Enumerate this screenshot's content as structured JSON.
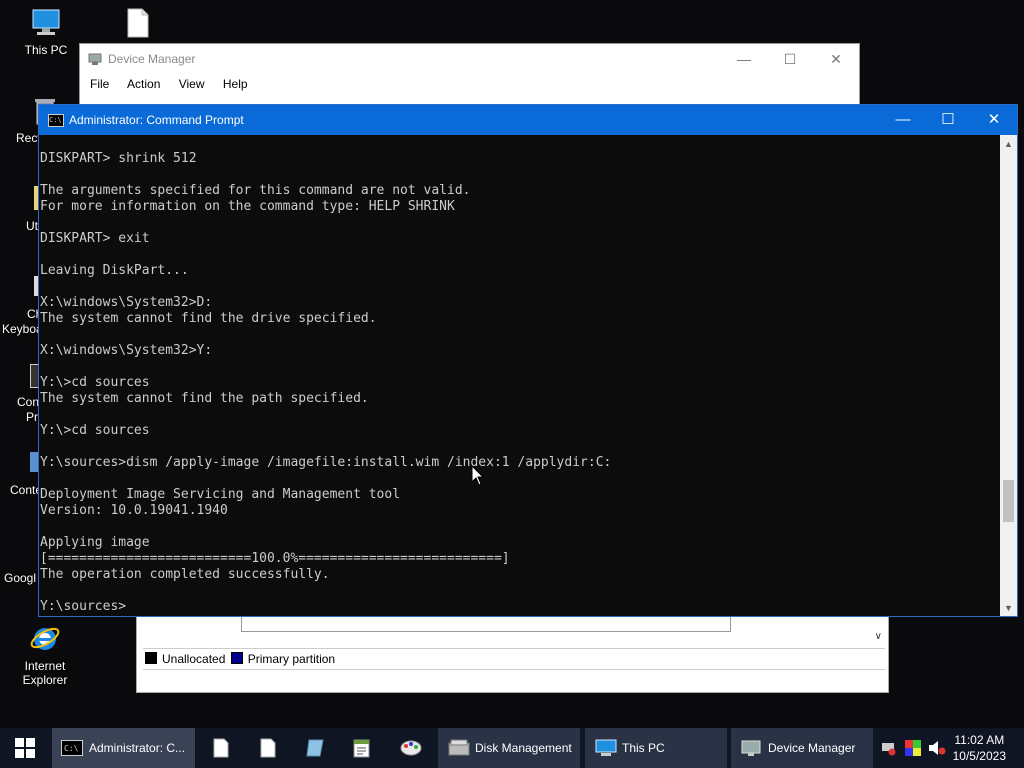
{
  "desktop": {
    "this_pc_label": "This PC",
    "internet_explorer_label": "Internet Explorer",
    "partial_labels": [
      "Recy",
      "Ut",
      "Ch",
      "Keyboa",
      "Con",
      "Pr",
      "Conte",
      "Googl"
    ]
  },
  "device_manager": {
    "title": "Device Manager",
    "menu": [
      "File",
      "Action",
      "View",
      "Help"
    ]
  },
  "disk_management": {
    "legend": [
      "Unallocated",
      "Primary partition"
    ],
    "legend_colors": [
      "#000000",
      "#00008b"
    ]
  },
  "cmd": {
    "title": "Administrator: Command Prompt",
    "lines": [
      "DISKPART> shrink 512",
      "",
      "The arguments specified for this command are not valid.",
      "For more information on the command type: HELP SHRINK",
      "",
      "DISKPART> exit",
      "",
      "Leaving DiskPart...",
      "",
      "X:\\windows\\System32>D:",
      "The system cannot find the drive specified.",
      "",
      "X:\\windows\\System32>Y:",
      "",
      "Y:\\>cd sources",
      "The system cannot find the path specified.",
      "",
      "Y:\\>cd sources",
      "",
      "Y:\\sources>dism /apply-image /imagefile:install.wim /index:1 /applydir:C:",
      "",
      "Deployment Image Servicing and Management tool",
      "Version: 10.0.19041.1940",
      "",
      "Applying image",
      "[==========================100.0%==========================]",
      "The operation completed successfully.",
      "",
      "Y:\\sources>"
    ]
  },
  "taskbar": {
    "items": [
      {
        "label": "Administrator: C...",
        "icon": "cmd-icon"
      },
      {
        "label": "",
        "icon": "file-icon"
      },
      {
        "label": "",
        "icon": "file-icon"
      },
      {
        "label": "",
        "icon": "book-icon"
      },
      {
        "label": "",
        "icon": "notepad-icon"
      },
      {
        "label": "",
        "icon": "paint-icon"
      },
      {
        "label": "Disk Management",
        "icon": "disk-management-icon"
      },
      {
        "label": "This PC",
        "icon": "computer-icon"
      },
      {
        "label": "Device Manager",
        "icon": "device-manager-icon"
      }
    ],
    "time": "11:02 AM",
    "date": "10/5/2023"
  }
}
